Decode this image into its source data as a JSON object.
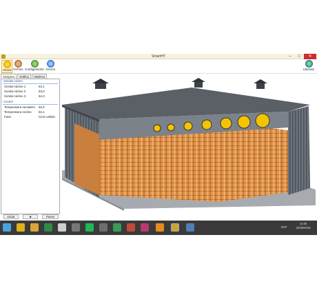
{
  "window": {
    "title": "SmartHT",
    "min_glyph": "–",
    "max_glyph": "□",
    "close_glyph": "✕"
  },
  "toolbar": {
    "ahora": "Ahora",
    "archivo": "Archivo",
    "configuracion": "Configuración",
    "acerca": "Acerca",
    "idiomas": "Idiomas"
  },
  "tabs": [
    "Sinóptico",
    "Gráfica",
    "Histórico"
  ],
  "panel": {
    "sondas_header": "Sondas núcleo",
    "sondas": [
      {
        "label": "Sonda núcleo 1",
        "value": "63,1"
      },
      {
        "label": "Sonda núcleo 2",
        "value": "63,0"
      },
      {
        "label": "Sonda núcleo 3",
        "value": "64,3"
      }
    ],
    "control_header": "Control",
    "control": [
      {
        "label": "Temperatura secadero",
        "value": "62,6"
      },
      {
        "label": "Temperatura núcleo",
        "value": "63,1"
      },
      {
        "label": "Fase",
        "value": "Ciclo validio"
      }
    ]
  },
  "buttons": {
    "iniciar": "Iniciar",
    "stop": "■",
    "pause": "Pause"
  },
  "taskbar": {
    "language": "ESP",
    "time": "13:30",
    "date": "22/06/2018"
  },
  "colors": {
    "accent": "#2d7d3a",
    "pallets": "#e0974e",
    "fans": "#f5c400",
    "roof": "#5a6066",
    "taskbar": "#3a3a3a"
  }
}
